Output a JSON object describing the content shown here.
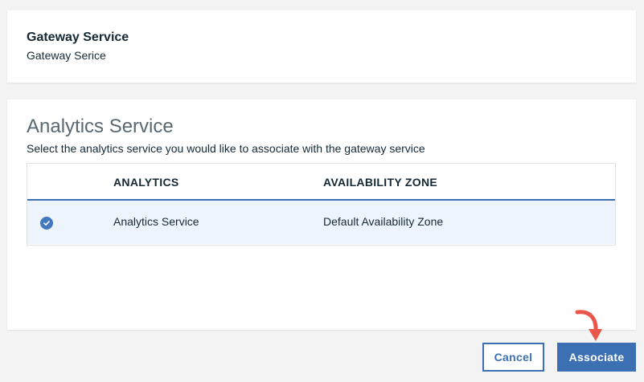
{
  "gateway": {
    "title": "Gateway Service",
    "subtitle": "Gateway Serice"
  },
  "analytics": {
    "title": "Analytics Service",
    "description": "Select the analytics service you would like to associate with the gateway service",
    "columns": [
      "ANALYTICS",
      "AVAILABILITY ZONE"
    ],
    "rows": [
      {
        "selected": true,
        "analytics": "Analytics Service",
        "zone": "Default Availability Zone"
      }
    ]
  },
  "actions": {
    "cancel_label": "Cancel",
    "associate_label": "Associate"
  },
  "colors": {
    "primary": "#3d70b2",
    "selected_row": "#eef4fc",
    "check": "#4178be",
    "annotation_arrow": "#e8574a"
  },
  "icons": {
    "row_check": "checkmark-circle-icon",
    "annotation": "curved-arrow-icon"
  }
}
